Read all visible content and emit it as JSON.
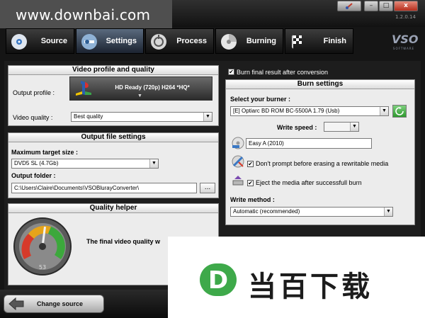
{
  "watermark": {
    "text": "www.downbai.com"
  },
  "window": {
    "version": "1.2.0.14",
    "logo_text": "VSO",
    "logo_sub": "SOFTWARE",
    "help_label": "",
    "min_label": "–",
    "max_label": "□",
    "close_label": "x"
  },
  "tabs": [
    {
      "label": "Source",
      "icon": "disc-icon"
    },
    {
      "label": "Settings",
      "icon": "settings-icon"
    },
    {
      "label": "Process",
      "icon": "process-icon"
    },
    {
      "label": "Burning",
      "icon": "burning-icon"
    },
    {
      "label": "Finish",
      "icon": "checkered-flag-icon"
    }
  ],
  "video_profile": {
    "title": "Video profile and quality",
    "output_profile_label": "Output profile :",
    "output_profile_value": "HD Ready (720p) H264 *HQ*",
    "profile_arrow": "▼",
    "video_quality_label": "Video quality :",
    "video_quality_value": "Best quality"
  },
  "output_file": {
    "title": "Output file settings",
    "max_size_label": "Maximum target size :",
    "max_size_value": "DVD5 SL (4.7Gb)",
    "folder_label": "Output folder :",
    "folder_value": "C:\\Users\\Claire\\Documents\\VSOBlurayConverter\\",
    "browse_label": "..."
  },
  "quality_helper": {
    "title": "Quality helper",
    "message": "The final video quality w",
    "gauge_value": "53",
    "gauge_level": 0.53
  },
  "burn": {
    "burn_final_label": "Burn final result after conversion",
    "burn_final_checked": "✔",
    "title": "Burn settings",
    "burner_label": "Select your burner :",
    "burner_value": "[E] Optiarc BD ROM BC-5500A 1.79 (Usb)",
    "write_speed_label": "Write speed :",
    "write_speed_value": "",
    "disc_label_value": "Easy A (2010)",
    "dont_prompt_label": "Don't prompt before erasing a rewritable media",
    "dont_prompt_checked": "✔",
    "eject_label": "Eject the media after successfull burn",
    "eject_checked": "✔",
    "write_method_label": "Write method :",
    "write_method_value": "Automatic (recommended)",
    "dropdown_arrow": "▼"
  },
  "bottom": {
    "change_source_label": "Change source"
  },
  "overlay": {
    "text": "当百下载",
    "logo_letter": "D"
  },
  "colors": {
    "accent_green": "#3ea94a",
    "active_tab": "#4a5a6e",
    "close_red": "#c0392b"
  }
}
